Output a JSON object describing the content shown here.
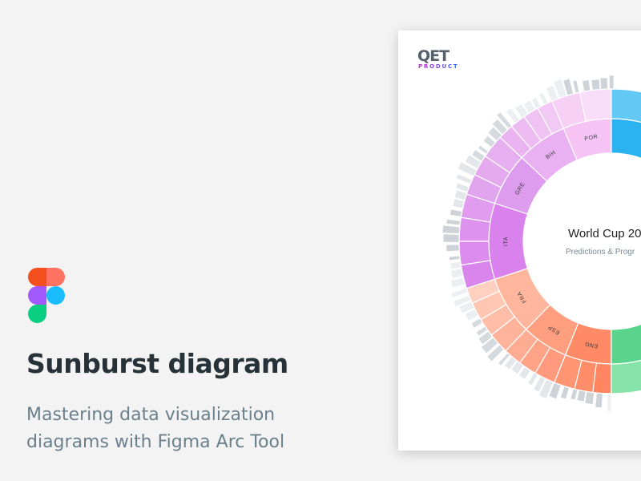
{
  "hero": {
    "title": "Sunburst diagram",
    "subtitle_line1": "Mastering data visualization",
    "subtitle_line2": "diagrams with Figma Arc Tool"
  },
  "logo": {
    "name": "figma-logo",
    "colors": [
      "#f24e1e",
      "#ff7262",
      "#a259ff",
      "#1abcfe",
      "#0acf83"
    ]
  },
  "card": {
    "brand_main": "QET",
    "brand_sub": "PRODUCT",
    "center_title": "World Cup 20",
    "center_subtitle": "Predictions & Progr",
    "colors": {
      "pink": "#f5c4f5",
      "purple": "#e4a0ef",
      "purple_deep": "#d981ec",
      "salmon": "#ffc0aa",
      "orange": "#ff8f6b",
      "orange_deep": "#ff7c57",
      "blue": "#2ab3f0",
      "blue_light": "#62c8f6",
      "green": "#5ad48c",
      "green_light": "#86e3a9",
      "gray": "#dde2e6"
    }
  },
  "sunburst": {
    "inner_ring": [
      {
        "label": "POR",
        "color": "#f5c4f5"
      },
      {
        "label": "BIH",
        "color": "#e9b0f2"
      },
      {
        "label": "GRE",
        "color": "#dd9cee"
      },
      {
        "label": "ITA",
        "color": "#d981ec"
      },
      {
        "label": "FRA",
        "color": "#ffb69c"
      },
      {
        "label": "ESP",
        "color": "#ff9f80"
      },
      {
        "label": "ENG",
        "color": "#ff8a66"
      }
    ]
  }
}
